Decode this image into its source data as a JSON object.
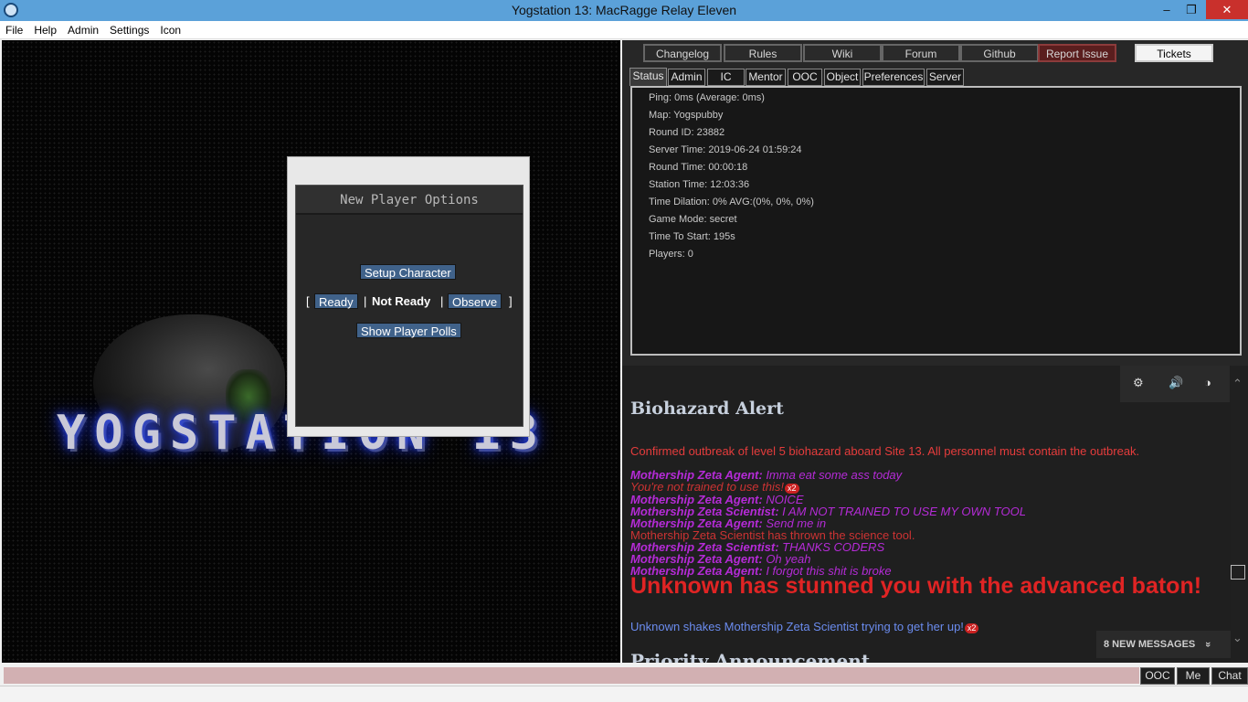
{
  "window": {
    "title": "Yogstation 13: MacRagge Relay Eleven",
    "minimize": "‒",
    "maximize": "❐",
    "close": "✕"
  },
  "menu": [
    "File",
    "Help",
    "Admin",
    "Settings",
    "Icon"
  ],
  "viewport": {
    "logo_text": "YOGSTATION 13"
  },
  "player_options": {
    "title": "New Player Options",
    "setup_character": "Setup Character",
    "bracket_open": "[",
    "ready": "Ready",
    "sep1": "|",
    "not_ready": "Not Ready",
    "sep2": "|",
    "observe": "Observe",
    "bracket_close": "]",
    "show_polls": "Show Player Polls"
  },
  "top_buttons": [
    "Changelog",
    "Rules",
    "Wiki",
    "Forum",
    "Github",
    "Report Issue",
    "Tickets"
  ],
  "tabs": [
    "Status",
    "Admin",
    "IC",
    "Mentor",
    "OOC",
    "Object",
    "Preferences",
    "Server"
  ],
  "status": [
    "Ping: 0ms (Average: 0ms)",
    "Map: Yogspubby",
    "Round ID: 23882",
    "Server Time: 2019-06-24 01:59:24",
    "Round Time: 00:00:18",
    "Station Time: 12:03:36",
    "Time Dilation: 0% AVG:(0%, 0%, 0%)",
    "Game Mode: secret",
    "Time To Start: 195s",
    "Players: 0"
  ],
  "chat": {
    "alert_title": "Biohazard Alert",
    "alert_text": "Confirmed outbreak of level 5 biohazard aboard Site 13. All personnel must contain the outbreak.",
    "lines": [
      {
        "speaker": "Mothership Zeta Agent:",
        "text": "Imma eat some ass today",
        "kind": "say"
      },
      {
        "speaker": "",
        "text": "You're not trained to use this!",
        "kind": "warn",
        "badge": "x2"
      },
      {
        "speaker": "Mothership Zeta Agent:",
        "text": "NOICE",
        "kind": "say"
      },
      {
        "speaker": "Mothership Zeta Scientist:",
        "text": "I AM NOT TRAINED TO USE MY OWN TOOL",
        "kind": "say"
      },
      {
        "speaker": "Mothership Zeta Agent:",
        "text": "Send me in",
        "kind": "say"
      },
      {
        "speaker": "",
        "text": "Mothership Zeta Scientist has thrown the science tool.",
        "kind": "warn"
      },
      {
        "speaker": "Mothership Zeta Scientist:",
        "text": "THANKS CODERS",
        "kind": "say"
      },
      {
        "speaker": "Mothership Zeta Agent:",
        "text": "Oh yeah",
        "kind": "say"
      },
      {
        "speaker": "Mothership Zeta Agent:",
        "text": "I forgot this shit is broke",
        "kind": "say"
      }
    ],
    "big_message": "Unknown has stunned you with the advanced baton!",
    "shake_message": "Unknown shakes Mothership Zeta Scientist trying to get her up!",
    "shake_badge": "x2",
    "priority_title": "Priority Announcement",
    "new_messages": "8 NEW MESSAGES",
    "new_messages_icon": "»",
    "controls": [
      "⚙",
      "🔊",
      "◑"
    ]
  },
  "input_buttons": [
    "OOC",
    "Me",
    "Chat"
  ],
  "colors": {
    "panel_bg": "#272727",
    "report_issue": "#5a1e1e",
    "speaker": "#b52bd7",
    "alert_red": "#e53c3c",
    "stun_red": "#e02424",
    "link_blue": "#6b8cef",
    "input_bar": "#d2b0b2"
  }
}
